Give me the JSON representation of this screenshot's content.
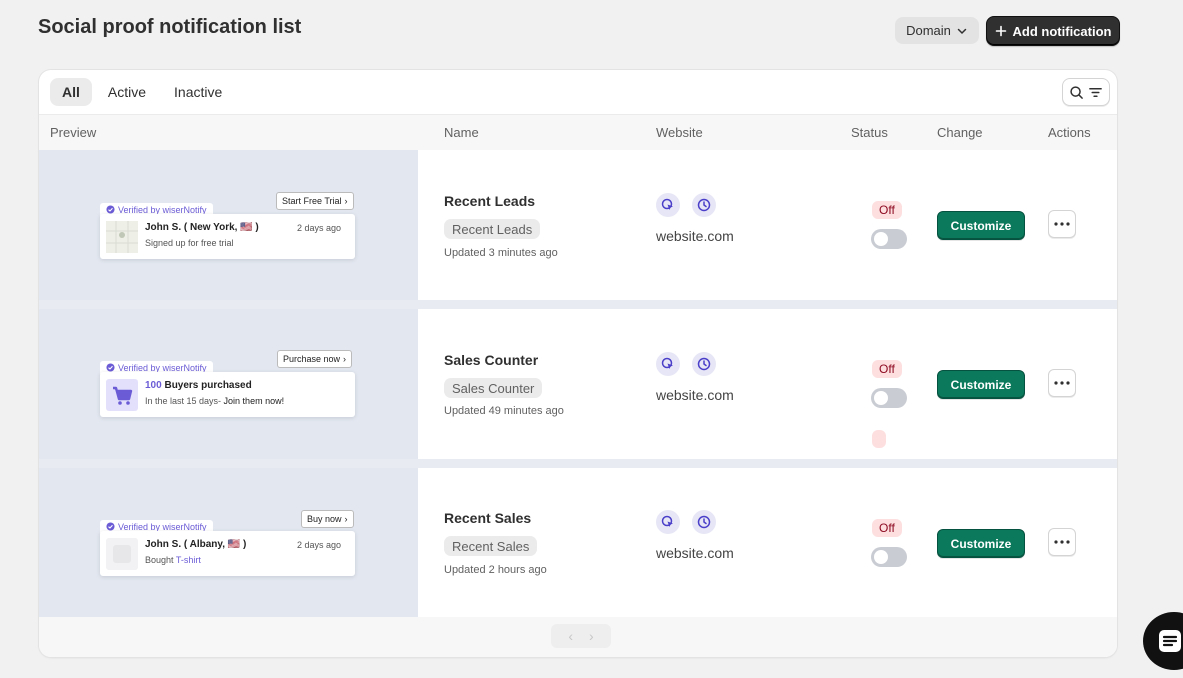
{
  "header": {
    "title": "Social proof notification list",
    "domain_label": "Domain",
    "add_label": "Add notification"
  },
  "tabs": [
    {
      "label": "All",
      "active": true
    },
    {
      "label": "Active",
      "active": false
    },
    {
      "label": "Inactive",
      "active": false
    }
  ],
  "columns": [
    "Preview",
    "Name",
    "Website",
    "Status",
    "Change",
    "Actions"
  ],
  "rows": [
    {
      "preview": {
        "verified": "Verified by wiserNotify",
        "cta": "Start Free Trial",
        "title": "John S. ( New York, 🇺🇸 )",
        "subtitle": "Signed up for free trial",
        "time": "2 days ago"
      },
      "name": "Recent Leads",
      "badge": "Recent Leads",
      "updated": "Updated 3 minutes ago",
      "website": "website.com",
      "status": "Off",
      "customize": "Customize"
    },
    {
      "preview": {
        "verified": "Verified by wiserNotify",
        "cta": "Purchase now",
        "count": "100",
        "title_rest": " Buyers purchased",
        "subtitle_a": "In the last 15 days- ",
        "subtitle_b": "Join them now!"
      },
      "name": "Sales Counter",
      "badge": "Sales Counter",
      "updated": "Updated 49 minutes ago",
      "website": "website.com",
      "status": "Off",
      "customize": "Customize"
    },
    {
      "preview": {
        "verified": "Verified by wiserNotify",
        "cta": "Buy now",
        "title": "John S. ( Albany, 🇺🇸 )",
        "subtitle_a": "Bought ",
        "subtitle_b": "T-shirt",
        "time": "2 days ago"
      },
      "name": "Recent Sales",
      "badge": "Recent Sales",
      "updated": "Updated 2 hours ago",
      "website": "website.com",
      "status": "Off",
      "customize": "Customize"
    }
  ],
  "pagination": {
    "prev": "‹",
    "next": "›"
  },
  "colors": {
    "accent": "#0b7a5c",
    "brand_purple": "#6b5cd6",
    "off_badge": "#fddfe0"
  },
  "icons": [
    "chevron-down-icon",
    "plus-icon",
    "search-icon",
    "filter-icon",
    "cursor-click-icon",
    "clock-icon",
    "more-horizontal-icon",
    "chat-icon"
  ]
}
